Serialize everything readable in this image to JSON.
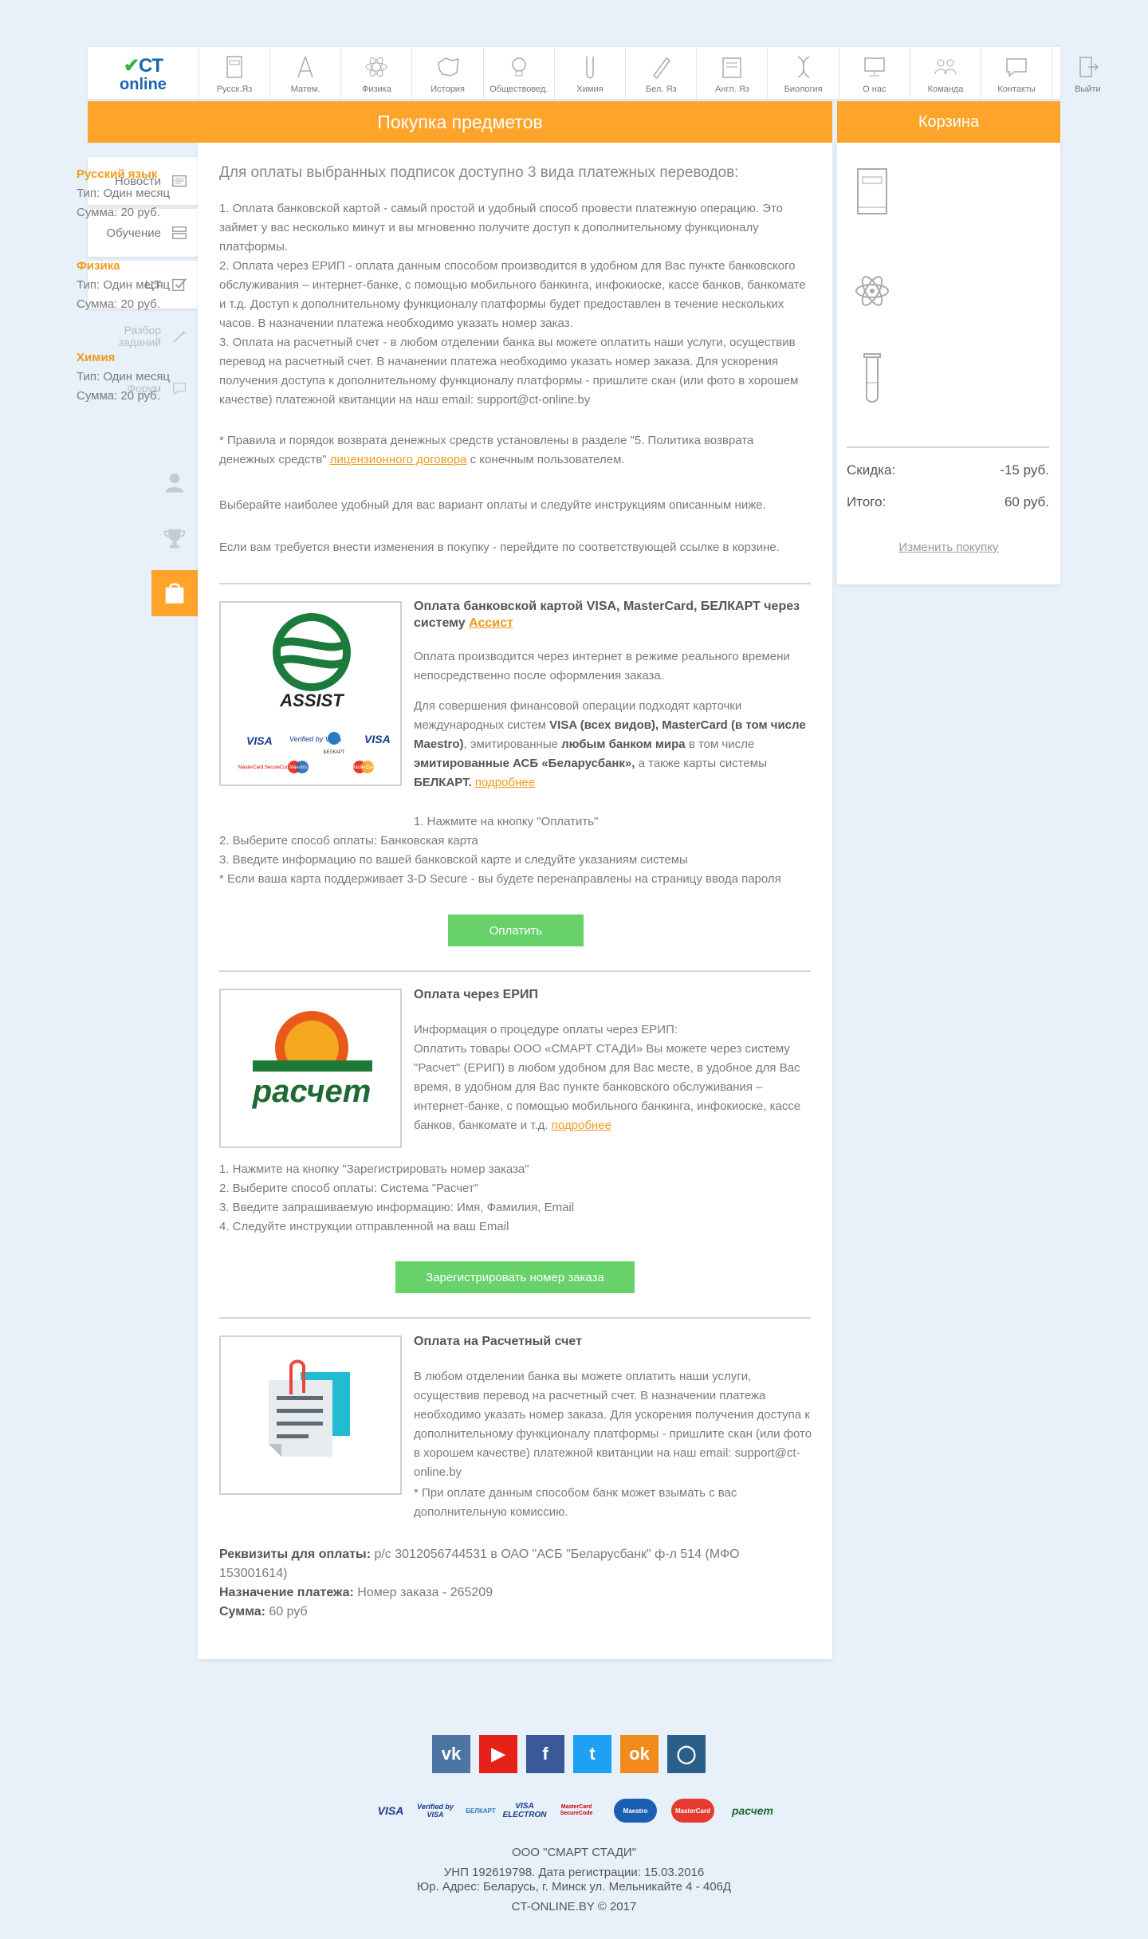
{
  "logo": {
    "ct": "CT",
    "online": "online"
  },
  "nav": [
    {
      "label": "Русск.Яз",
      "icon": "book-icon"
    },
    {
      "label": "Матем.",
      "icon": "compass-icon"
    },
    {
      "label": "Физика",
      "icon": "atom-icon"
    },
    {
      "label": "История",
      "icon": "map-icon"
    },
    {
      "label": "Обществовед.",
      "icon": "lightbulb-icon"
    },
    {
      "label": "Химия",
      "icon": "test-tube-icon"
    },
    {
      "label": "Бел. Яз",
      "icon": "pen-icon"
    },
    {
      "label": "Англ. Яз",
      "icon": "dictionary-icon"
    },
    {
      "label": "Биология",
      "icon": "dna-icon"
    },
    {
      "label": "О нас",
      "icon": "monitor-icon"
    },
    {
      "label": "Команда",
      "icon": "team-icon"
    },
    {
      "label": "Контакты",
      "icon": "chat-icon"
    },
    {
      "label": "Выйти",
      "icon": "exit-icon"
    }
  ],
  "header": {
    "main_title": "Покупка предметов",
    "cart_title": "Корзина"
  },
  "sidebar": {
    "news": "Новости",
    "learning": "Обучение",
    "ct": "ЦТ",
    "review": "Разбор заданий",
    "forum": "Форум"
  },
  "intro": {
    "heading": "Для оплаты выбранных подписок доступно 3 вида платежных переводов:",
    "p1": "1. Оплата банковской картой - самый простой и удобный способ провести платежную операцию. Это займет у вас несколько минут и вы мгновенно получите доступ к дополнительному функционалу платформы.",
    "p2": "2. Оплата через ЕРИП - оплата данным способом производится в удобном для Вас пункте банковского обслуживания – интернет-банке, с помощью мобильного банкинга, инфокиоске, кассе банков, банкомате и т.д. Доступ к дополнительному функционалу платформы будет предоставлен в течение нескольких часов. В назначении платежа необходимо указать номер заказ.",
    "p3": "3. Оплата на расчетный счет - в любом отделении банка вы можете оплатить наши услуги, осуществив перевод на расчетный счет. В начанении платежа необходимо указать номер заказа. Для ускорения получения доступа к дополнительному функционалу платформы - пришлите скан (или фото в хорошем качестве) платежной квитанции на наш email: support@ct-online.by",
    "refund_a": "* Правила и порядок возврата денежных средств установлены в разделе \"5. Политика возврата денежных средств\" ",
    "refund_link": "лицензионного договора",
    "refund_b": " с конечным пользователем.",
    "choose": "Выберайте наиболее удобный для вас вариант оплаты и следуйте инструкциям описанным ниже.",
    "change": "Если вам требуется внести изменения в покупку - перейдите по соответствующей ссылке в корзине."
  },
  "card": {
    "title": "Оплата банковской картой VISA, MasterCard, БЕЛКАРТ через систему ",
    "title_link": "Ассист",
    "logo_text": "ASSIST",
    "p1": "Оплата производится через интернет в режиме реального времени непосредственно после оформления заказа.",
    "p2_a": "Для совершения финансовой операции подходят карточки международных систем ",
    "p2_b": "VISA (всех видов), MasterCard (в том числе Maestro)",
    "p2_c": ", эмитированные ",
    "p2_d": "любым банком мира",
    "p2_e": " в том числе ",
    "p2_f": "эмитированные АСБ «Беларусбанк»,",
    "p2_g": " а также карты системы ",
    "p2_h": "БЕЛКАРТ.",
    "more": "подробнее",
    "steps": [
      "1. Нажмите на кнопку \"Оплатить\"",
      "2. Выберите способ оплаты: Банковская карта",
      "3. Введите информацию по вашей банковской карте и следуйте указаниям системы",
      "* Если ваша карта поддерживает 3-D Secure - вы будете перенаправлены на страницу ввода пароля"
    ],
    "button": "Оплатить",
    "brands": [
      "VISA",
      "Verified by VISA",
      "БЕЛКАРТ",
      "VISA",
      "MasterCard SecureCode",
      "Maestro",
      "MasterCard"
    ]
  },
  "erip": {
    "title": "Оплата через ЕРИП",
    "logo_text": "расчет",
    "p1": "Информация о процедуре оплаты через ЕРИП:",
    "p2": "Оплатить товары ООО «СМАРТ СТАДИ» Вы можете через систему \"Расчет\" (ЕРИП) в любом удобном для Вас месте, в удобное для Вас время, в удобном для Вас пункте банковского обслуживания – интернет-банке, с помощью мобильного банкинга, инфокиоске, кассе банков, банкомате и т.д. ",
    "more": "подробнее",
    "steps": [
      "1. Нажмите на кнопку \"Зарегистрировать номер заказа\"",
      "2. Выберите способ оплаты: Система \"Расчет\"",
      "3. Введите запрашиваемую информацию: Имя, Фамилия, Email",
      "4. Следуйте инструкции отправленной на ваш Email"
    ],
    "button": "Зарегистрировать номер заказа"
  },
  "account": {
    "title": "Оплата на Расчетный счет",
    "p1": "В любом отделении банка вы можете оплатить наши услуги, осуществив перевод на расчетный счет. В назначении платежа необходимо указать номер заказа. Для ускорения получения доступа к дополнительному функционалу платформы - пришлите скан (или фото в хорошем качестве) платежной квитанции на наш email: support@ct-online.by",
    "p2": "* При оплате данным способом банк может взымать с вас дополнительную комиссию.",
    "req_label": "Реквизиты для оплаты:",
    "req_value": " р/с 3012056744531 в ОАО \"АСБ \"Беларусбанк\" ф-л 514 (МФО 153001614)",
    "purpose_label": "Назначение платежа:",
    "purpose_value": " Номер заказа - 265209",
    "sum_label": "Сумма:",
    "sum_value": " 60 руб"
  },
  "cart": {
    "items": [
      {
        "name": "Русский язык",
        "type": "Тип: Один месяц",
        "sum": "Сумма: 20 руб.",
        "icon": "book-icon"
      },
      {
        "name": "Физика",
        "type": "Тип: Один месяц",
        "sum": "Сумма: 20 руб.",
        "icon": "atom-icon"
      },
      {
        "name": "Химия",
        "type": "Тип: Один месяц",
        "sum": "Сумма: 20 руб.",
        "icon": "test-tube-icon"
      }
    ],
    "discount_label": "Скидка:",
    "discount_value": "-15 руб.",
    "total_label": "Итого:",
    "total_value": "60 руб.",
    "change_link": "Изменить покупку"
  },
  "footer": {
    "social": [
      "vk",
      "youtube",
      "facebook",
      "twitter",
      "odnoklassniki",
      "instagram"
    ],
    "payments": [
      "VISA",
      "Verified by VISA",
      "БЕЛКАРТ",
      "VISA ELECTRON",
      "MasterCard SecureCode",
      "Maestro",
      "MasterCard",
      "расчет"
    ],
    "company": "ООО \"СМАРТ СТАДИ\"",
    "unp": "УНП 192619798. Дата регистрации: 15.03.2016",
    "address": "Юр. Адрес: Беларусь, г. Минск ул. Мельникайте 4 - 406Д",
    "copyright": "CT-ONLINE.BY © 2017"
  },
  "colors": {
    "accent": "#ffa42b",
    "button": "#67d16a",
    "link": "#f19a1b",
    "brand_blue": "#1b64b1",
    "background": "#e8f1f9"
  }
}
